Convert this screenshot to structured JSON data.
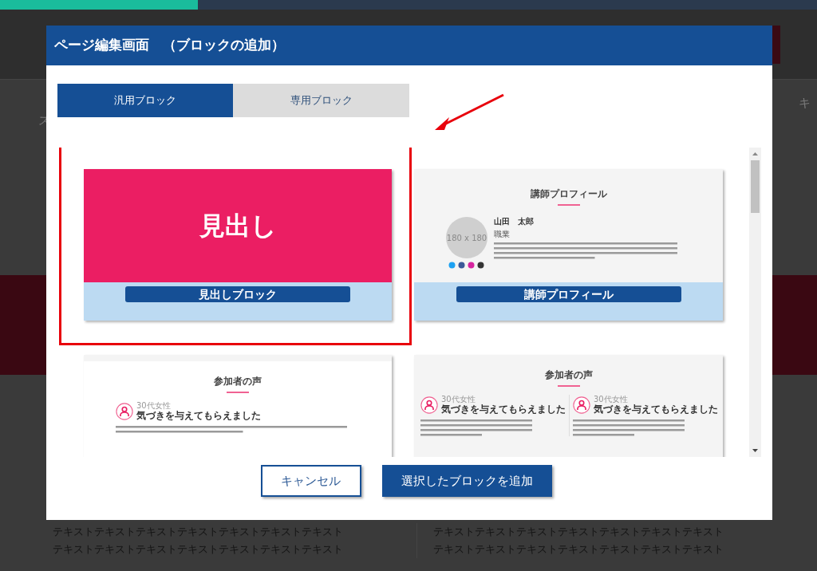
{
  "background": {
    "fragments_left": [
      "ス"
    ],
    "fragment_right": "キ",
    "text_columns": [
      [
        "テキストテキストテキストテキストテキストテキストテキスト",
        "テキストテキストテキストテキストテキストテキストテキスト"
      ],
      [
        "テキストテキストテキストテキストテキストテキストテキスト",
        "テキストテキストテキストテキストテキストテキストテキスト"
      ]
    ]
  },
  "dialog": {
    "title": "ページ編集画面　（ブロックの追加）",
    "tabs": [
      {
        "label": "汎用ブロック",
        "selected": true
      },
      {
        "label": "専用ブロック",
        "selected": false
      }
    ],
    "blocks": [
      {
        "kind": "heading",
        "selected": true,
        "preview_heading": "見出し",
        "label": "見出しブロック"
      },
      {
        "kind": "profile",
        "selected": false,
        "section_title": "講師プロフィール",
        "avatar": "180 x 180",
        "name": "山田　太郎",
        "role": "職業",
        "label": "講師プロフィール"
      },
      {
        "kind": "voice",
        "selected": false,
        "shaded": false,
        "section_title": "参加者の声",
        "entries": [
          {
            "meta": "30代女性",
            "headline": "気づきを与えてもらえました"
          }
        ]
      },
      {
        "kind": "voice",
        "selected": false,
        "shaded": true,
        "section_title": "参加者の声",
        "entries": [
          {
            "meta": "30代女性",
            "headline": "気づきを与えてもらえました"
          },
          {
            "meta": "30代女性",
            "headline": "気づきを与えてもらえました"
          }
        ]
      }
    ],
    "buttons": [
      {
        "label": "キャンセル",
        "kind": "secondary"
      },
      {
        "label": "選択したブロックを追加",
        "kind": "primary"
      }
    ]
  }
}
